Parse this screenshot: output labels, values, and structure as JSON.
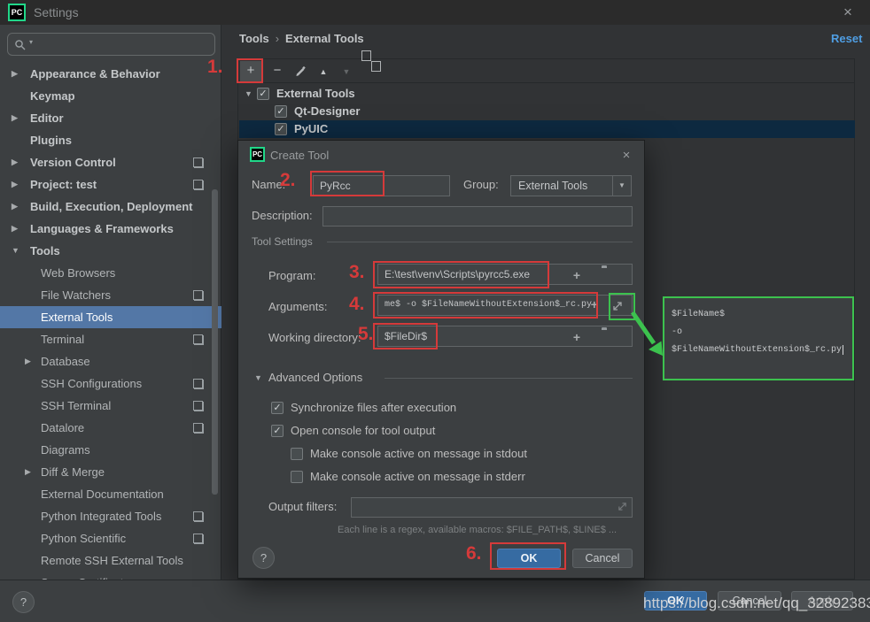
{
  "window": {
    "title": "Settings",
    "logo": "PC"
  },
  "icons": {
    "close": "×",
    "check": "✓",
    "add": "+",
    "remove": "−",
    "up": "▲",
    "down": "▼",
    "combo_arrow": "▼",
    "branch_open": "▼",
    "branch_closed": "▶",
    "help": "?",
    "search_arrow": "▾",
    "breadcrumb_sep": "›"
  },
  "sidebar": {
    "search_placeholder": "",
    "items": [
      {
        "label": "Appearance & Behavior",
        "level": 0,
        "arrow": "closed"
      },
      {
        "label": "Keymap",
        "level": 0
      },
      {
        "label": "Editor",
        "level": 0,
        "arrow": "closed"
      },
      {
        "label": "Plugins",
        "level": 0
      },
      {
        "label": "Version Control",
        "level": 0,
        "arrow": "closed",
        "badge": true
      },
      {
        "label": "Project: test",
        "level": 0,
        "arrow": "closed",
        "badge": true
      },
      {
        "label": "Build, Execution, Deployment",
        "level": 0,
        "arrow": "closed"
      },
      {
        "label": "Languages & Frameworks",
        "level": 0,
        "arrow": "closed"
      },
      {
        "label": "Tools",
        "level": 0,
        "arrow": "open"
      },
      {
        "label": "Web Browsers",
        "level": 1
      },
      {
        "label": "File Watchers",
        "level": 1,
        "badge": true
      },
      {
        "label": "External Tools",
        "level": 1,
        "selected": true
      },
      {
        "label": "Terminal",
        "level": 1,
        "badge": true
      },
      {
        "label": "Database",
        "level": 1,
        "arrow": "closed"
      },
      {
        "label": "SSH Configurations",
        "level": 1,
        "badge": true
      },
      {
        "label": "SSH Terminal",
        "level": 1,
        "badge": true
      },
      {
        "label": "Datalore",
        "level": 1,
        "badge": true
      },
      {
        "label": "Diagrams",
        "level": 1
      },
      {
        "label": "Diff & Merge",
        "level": 1,
        "arrow": "closed"
      },
      {
        "label": "External Documentation",
        "level": 1
      },
      {
        "label": "Python Integrated Tools",
        "level": 1,
        "badge": true
      },
      {
        "label": "Python Scientific",
        "level": 1,
        "badge": true
      },
      {
        "label": "Remote SSH External Tools",
        "level": 1
      },
      {
        "label": "Server Certificates",
        "level": 1
      }
    ]
  },
  "content": {
    "breadcrumb": {
      "parent": "Tools",
      "current": "External Tools"
    },
    "reset_label": "Reset",
    "tree": [
      {
        "label": "External Tools",
        "level": 0,
        "checked": true,
        "arrow": "open"
      },
      {
        "label": "Qt-Designer",
        "level": 1,
        "checked": true
      },
      {
        "label": "PyUIC",
        "level": 1,
        "checked": true,
        "selected": true
      }
    ]
  },
  "dialog": {
    "title": "Create Tool",
    "name_label": "Name:",
    "name_value": "PyRcc",
    "group_label": "Group:",
    "group_value": "External Tools",
    "description_label": "Description:",
    "description_value": "",
    "tool_settings_label": "Tool Settings",
    "program_label": "Program:",
    "program_value": "E:\\test\\venv\\Scripts\\pyrcc5.exe",
    "arguments_label": "Arguments:",
    "arguments_value": "me$ -o $FileNameWithoutExtension$_rc.py",
    "workdir_label": "Working directory:",
    "workdir_value": "$FileDir$",
    "advanced_label": "Advanced Options",
    "checkboxes": [
      {
        "label": "Synchronize files after execution",
        "checked": true,
        "indent": false
      },
      {
        "label": "Open console for tool output",
        "checked": true,
        "indent": false
      },
      {
        "label": "Make console active on message in stdout",
        "checked": false,
        "indent": true
      },
      {
        "label": "Make console active on message in stderr",
        "checked": false,
        "indent": true
      }
    ],
    "output_filters_label": "Output filters:",
    "output_filters_value": "",
    "hint": "Each line is a regex, available macros: $FILE_PATH$, $LINE$ ...",
    "ok_label": "OK",
    "cancel_label": "Cancel",
    "help": "?"
  },
  "popup": {
    "lines": [
      "$FileName$",
      "-o",
      "$FileNameWithoutExtension$_rc.py"
    ]
  },
  "annotations": {
    "step1": "1.",
    "step2": "2.",
    "step3": "3.",
    "step4": "4.",
    "step5": "5.",
    "step6": "6."
  },
  "footer": {
    "ok_label": "OK",
    "cancel_label": "Cancel",
    "apply_label": "Apply",
    "help": "?",
    "watermark": "https://blog.csdn.net/qq_32892383"
  },
  "colors": {
    "accent_red": "#d53a3a",
    "accent_green": "#3cc24e",
    "link_blue": "#4f9ee3",
    "selection_blue": "#5377a6",
    "tree_selection_navy": "#0d2940",
    "ok_button_blue": "#366ba2"
  }
}
